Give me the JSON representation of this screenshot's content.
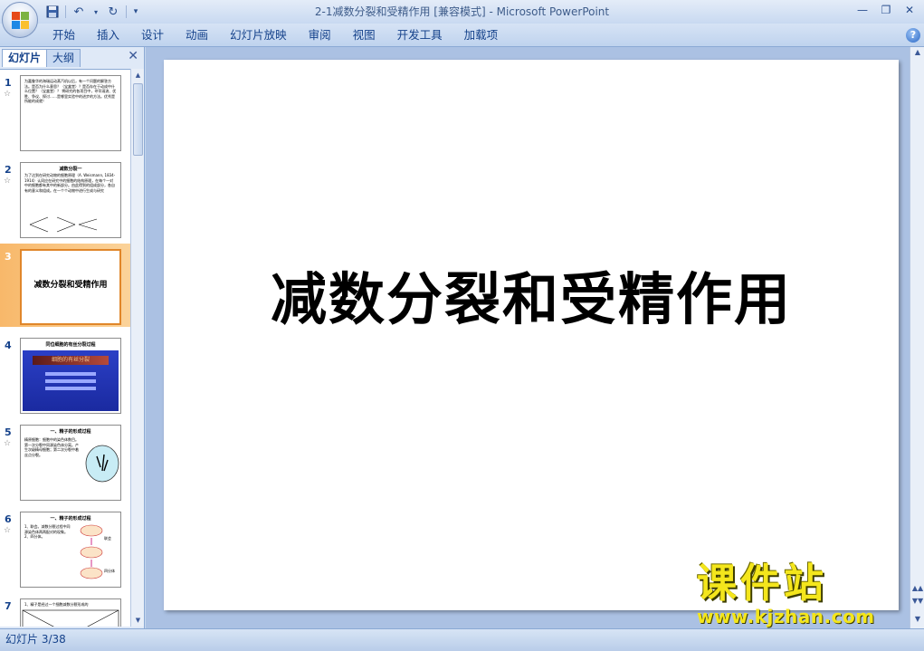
{
  "titlebar": {
    "title": "2-1减数分裂和受精作用 [兼容模式] - Microsoft PowerPoint",
    "qat": [
      "save-icon",
      "undo-icon",
      "redo-icon",
      "customize-icon"
    ]
  },
  "ribbon": {
    "tabs": [
      "开始",
      "插入",
      "设计",
      "动画",
      "幻灯片放映",
      "审阅",
      "视图",
      "开发工具",
      "加载项"
    ]
  },
  "left_pane": {
    "tabs": [
      "幻灯片",
      "大纲"
    ],
    "slides": [
      {
        "num": "1",
        "text": "为嘉鲁华的海瑞运动蒸汽机以后，有一个问题的解答方法。是否为什么意思？（宝盒堂）？是否存在于动成中什么位置？（宝盒堂）？ 将研究的各项目中，寻早溺流、优胜、争议、探讨……是哪里实验中的进步的方法。优秀是所能的成就！"
      },
      {
        "num": "2",
        "head": "减数分裂一",
        "text": "为了达到在研究动物的细胞原理（A. Weismann, 1834-1914）认同应在研究中的细胞的结构原理，在每个一对中的细胞都有其中的新部分。由此得到的组成部分，各自有的意义和组成。在一个个动物中进行生成与研究"
      },
      {
        "num": "3",
        "head": "减数分裂和受精作用"
      },
      {
        "num": "4",
        "head": "同位细胞的有丝分裂过程",
        "banner": "细胞的有丝分裂"
      },
      {
        "num": "5",
        "head": "一、精子的形成过程",
        "text": "精原细胞：细胞中的染色体数目。第一次分裂中同源染色体分离。产生次级精母细胞；第二次分裂中着丝点分裂。"
      },
      {
        "num": "6",
        "head": "一、精子的形成过程",
        "text": "1、联会。减数分裂过程中同源染色体两两配对的现象。2、四分体。"
      },
      {
        "num": "7",
        "text": "1、精子是经过一个细胞减数分裂形成的"
      }
    ],
    "labels": {
      "lianhui": "联会",
      "sifenti": "四分体"
    }
  },
  "slide": {
    "title": "减数分裂和受精作用"
  },
  "watermark": {
    "top": "课件站",
    "bottom": "www.kjzhan.com"
  },
  "status": {
    "text": "幻灯片 3/38"
  },
  "colors": {
    "accent": "#15428b",
    "selected": "#f8b86a",
    "watermark": "#f4e61c"
  }
}
